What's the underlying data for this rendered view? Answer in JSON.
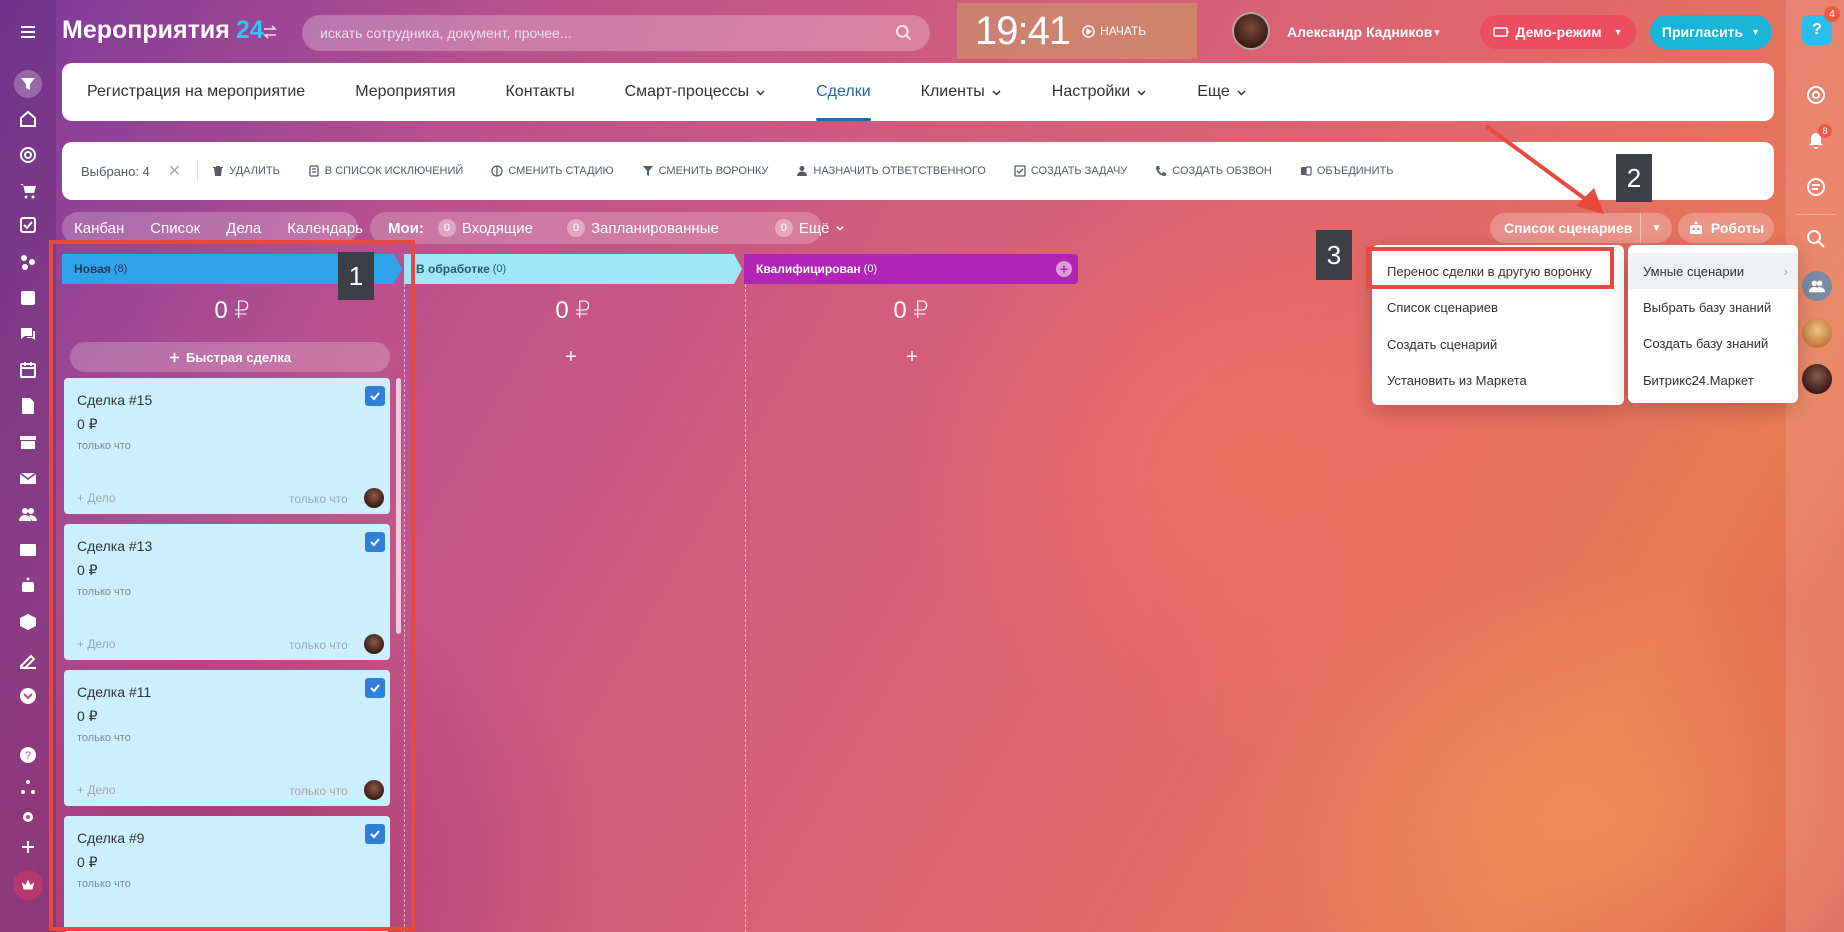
{
  "header": {
    "app_title": "Мероприятия",
    "app_title_num": "24",
    "search_placeholder": "искать сотрудника, документ, прочее...",
    "clock": "19:41",
    "start_label": "НАЧАТЬ",
    "user_name": "Александр Кадников",
    "demo_label": "Демо-режим",
    "invite_label": "Пригласить",
    "help_label": "?",
    "help_badge": "4"
  },
  "right_sidebar": {
    "notifications_badge": "8"
  },
  "nav": {
    "items": [
      {
        "label": "Регистрация на мероприятие"
      },
      {
        "label": "Мероприятия"
      },
      {
        "label": "Контакты"
      },
      {
        "label": "Смарт-процессы"
      },
      {
        "label": "Сделки"
      },
      {
        "label": "Клиенты"
      },
      {
        "label": "Настройки"
      },
      {
        "label": "Еще"
      }
    ]
  },
  "actions": {
    "selected": "Выбрано: 4",
    "items": [
      {
        "label": "УДАЛИТЬ"
      },
      {
        "label": "В СПИСОК ИСКЛЮЧЕНИЙ"
      },
      {
        "label": "СМЕНИТЬ СТАДИЮ"
      },
      {
        "label": "СМЕНИТЬ ВОРОНКУ"
      },
      {
        "label": "НАЗНАЧИТЬ ОТВЕТСТВЕННОГО"
      },
      {
        "label": "СОЗДАТЬ ЗАДАЧУ"
      },
      {
        "label": "СОЗДАТЬ ОБЗВОН"
      },
      {
        "label": "ОБЪЕДИНИТЬ"
      }
    ]
  },
  "views": {
    "kanban": "Канбан",
    "list": "Список",
    "activities": "Дела",
    "calendar": "Календарь"
  },
  "mine": {
    "label": "Мои:",
    "incoming_count": "0",
    "incoming": "Входящие",
    "planned_count": "0",
    "planned": "Запланированные",
    "more_count": "0",
    "more": "Ещё"
  },
  "toolbar": {
    "scenarios": "Список сценариев",
    "robots": "Роботы"
  },
  "columns": [
    {
      "name": "Новая",
      "count": "(8)",
      "sum": "0 ₽"
    },
    {
      "name": "В обработке",
      "count": "(0)",
      "sum": "0 ₽"
    },
    {
      "name": "Квалифицирован",
      "count": "(0)",
      "sum": "0 ₽"
    }
  ],
  "quick_deal": "Быстрая сделка",
  "cards": [
    {
      "title": "Сделка #15",
      "sum": "0 ₽",
      "time": "только что",
      "add": "+ Дело",
      "time2": "только что"
    },
    {
      "title": "Сделка #13",
      "sum": "0 ₽",
      "time": "только что",
      "add": "+ Дело",
      "time2": "только что"
    },
    {
      "title": "Сделка #11",
      "sum": "0 ₽",
      "time": "только что",
      "add": "+ Дело",
      "time2": "только что"
    },
    {
      "title": "Сделка #9",
      "sum": "0 ₽",
      "time": "только что",
      "add": "",
      "time2": ""
    }
  ],
  "menu_main": [
    {
      "label": "Перенос сделки в другую воронку"
    },
    {
      "label": "Список сценариев"
    },
    {
      "label": "Создать сценарий"
    },
    {
      "label": "Установить из Маркета"
    }
  ],
  "menu_sub": [
    {
      "label": "Умные сценарии"
    },
    {
      "label": "Выбрать базу знаний"
    },
    {
      "label": "Создать базу знаний"
    },
    {
      "label": "Битрикс24.Маркет"
    }
  ],
  "annotations": {
    "one": "1",
    "two": "2",
    "three": "3"
  },
  "colors": {
    "accent_blue": "#2066b0",
    "col_new": "#2fa4eb",
    "col_proc": "#9fe6f6",
    "col_qual": "#b125b6",
    "card_bg": "#cbeffd",
    "annotation_red": "#e8493d"
  }
}
